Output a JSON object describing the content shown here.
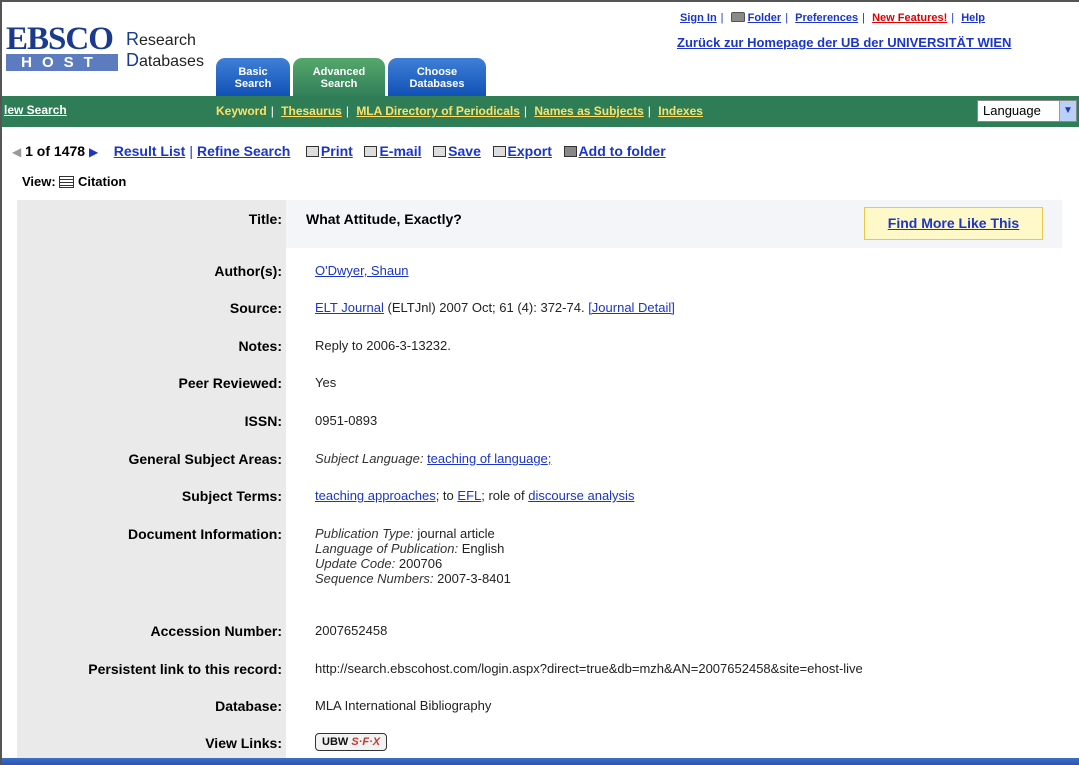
{
  "header": {
    "logo_top": "EBSCO",
    "logo_bottom": "HOST",
    "brand_line1": "esearch",
    "brand_line1_cap": "R",
    "brand_line2": "atabases",
    "brand_line2_cap": "D",
    "tabs": [
      {
        "line1": "Basic",
        "line2": "Search"
      },
      {
        "line1": "Advanced",
        "line2": "Search"
      },
      {
        "line1": "Choose",
        "line2": "Databases"
      }
    ],
    "top_links": {
      "sign_in": "Sign In",
      "folder": "Folder",
      "preferences": "Preferences",
      "new_features": "New Features!",
      "help": "Help"
    },
    "homepage_link": "Zurück zur Homepage der UB der UNIVERSITÄT WIEN"
  },
  "nav": {
    "new_search": "lew Search",
    "keyword": "Keyword",
    "thesaurus": "Thesaurus",
    "mla_directory": "MLA Directory of Periodicals",
    "names_as_subjects": "Names as Subjects",
    "indexes": "Indexes",
    "language": "Language"
  },
  "results_bar": {
    "count": "1 of 1478",
    "result_list": "Result List",
    "refine_search": "Refine Search",
    "print": "Print",
    "email": "E-mail",
    "save": "Save",
    "export": "Export",
    "add_to_folder": "Add to folder"
  },
  "view": {
    "label": "View:",
    "value": "Citation"
  },
  "record": {
    "title_label": "Title:",
    "title": "What Attitude, Exactly?",
    "find_more": "Find More Like This",
    "authors_label": "Author(s):",
    "authors": "O'Dwyer, Shaun",
    "source_label": "Source:",
    "source_journal": "ELT Journal",
    "source_rest": "(ELTJnl) 2007 Oct; 61 (4): 372-74.",
    "journal_detail": "[Journal Detail]",
    "notes_label": "Notes:",
    "notes": "Reply to 2006-3-13232.",
    "peer_label": "Peer Reviewed:",
    "peer": "Yes",
    "issn_label": "ISSN:",
    "issn": "0951-0893",
    "gsa_label": "General Subject Areas:",
    "gsa_prefix": "Subject Language:",
    "gsa_link": "teaching of language",
    "gsa_suffix": ";",
    "terms_label": "Subject Terms:",
    "terms_link1": "teaching approaches",
    "terms_mid1": "; to",
    "terms_link2": "EFL",
    "terms_mid2": "; role of",
    "terms_link3": "discourse analysis",
    "docinfo_label": "Document Information:",
    "pubtype_label": "Publication Type:",
    "pubtype": "journal article",
    "lang_label": "Language of Publication:",
    "lang": "English",
    "update_label": "Update Code:",
    "update": "200706",
    "seq_label": "Sequence Numbers:",
    "seq": "2007-3-8401",
    "accession_label": "Accession Number:",
    "accession": "2007652458",
    "persist_label": "Persistent link to this record:",
    "persist": "http://search.ebscohost.com/login.aspx?direct=true&db=mzh&AN=2007652458&site=ehost-live",
    "database_label": "Database:",
    "database": "MLA International Bibliography",
    "viewlinks_label": "View Links:",
    "sfx_prefix": "UBW",
    "sfx_logo": "S·F·X"
  }
}
